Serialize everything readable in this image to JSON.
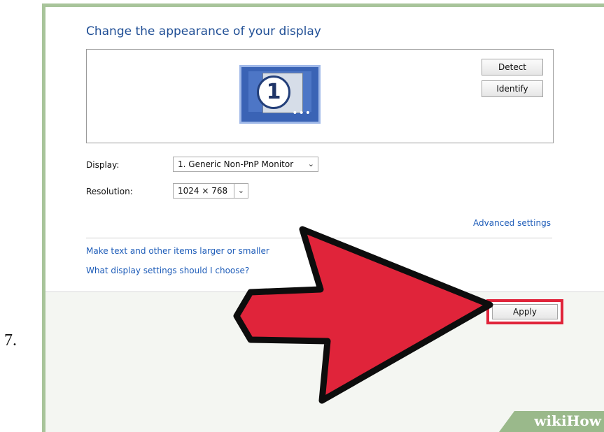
{
  "step": {
    "number": "7."
  },
  "page": {
    "title": "Change the appearance of your display"
  },
  "preview": {
    "monitor_number": "1"
  },
  "buttons": {
    "detect": "Detect",
    "identify": "Identify",
    "apply": "Apply"
  },
  "fields": {
    "display": {
      "label": "Display:",
      "value": "1. Generic Non-PnP Monitor"
    },
    "resolution": {
      "label": "Resolution:",
      "value": "1024 × 768"
    }
  },
  "links": {
    "advanced": "Advanced settings",
    "text_size": "Make text and other items larger or smaller",
    "help": "What display settings should I choose?"
  },
  "annotation": {
    "arrow_color": "#e0243a",
    "highlight_color": "#e0243a",
    "accent": "#1f4e95"
  },
  "watermark": {
    "text": "wikiHow"
  }
}
